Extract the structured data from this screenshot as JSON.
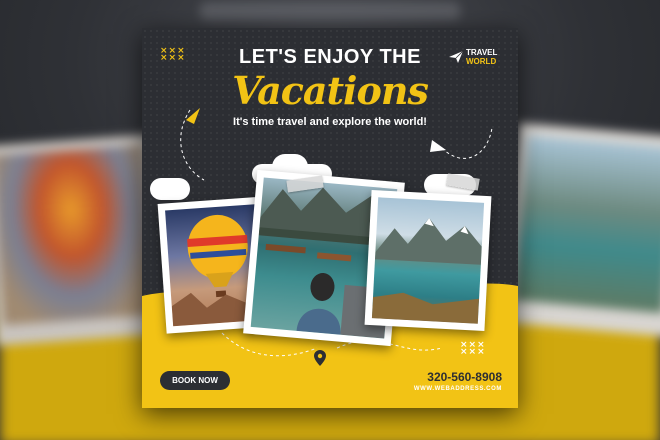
{
  "brand": {
    "line1": "TRAVEL",
    "line2": "WORLD"
  },
  "headline": "LET'S ENJOY THE",
  "script_title": "Vacations",
  "tagline": "It's time travel and explore the world!",
  "cta": {
    "label": "BOOK NOW"
  },
  "contact": {
    "phone": "320-560-8908",
    "website": "WWW.WEBADDRESS.COM"
  },
  "decor": {
    "x_marks_top": "×××\n×××",
    "x_marks_bottom": "×××\n×××"
  },
  "colors": {
    "accent": "#f2c315",
    "card_dark": "#2c2e33",
    "white": "#ffffff"
  },
  "icons": [
    "paper-plane-icon",
    "location-pin-icon",
    "x-pattern-icon"
  ],
  "photos": [
    "hot-air-balloon-photo",
    "mountain-lake-boats-photo",
    "alpine-lake-photo"
  ]
}
